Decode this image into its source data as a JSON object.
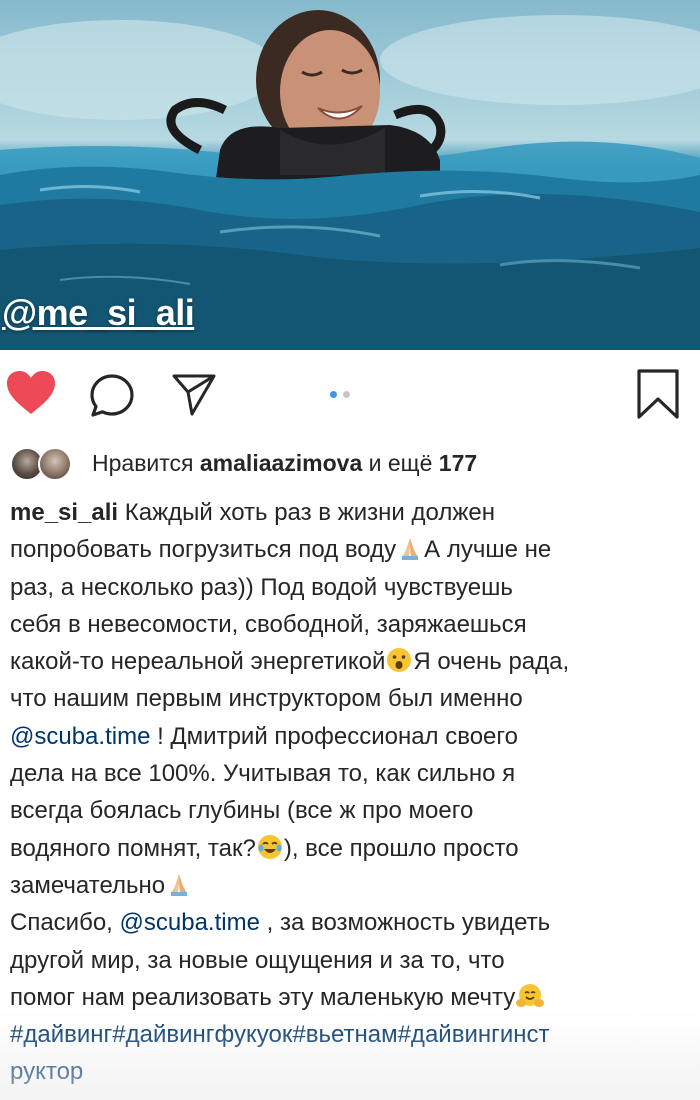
{
  "photo": {
    "overlay_mention": "@me_si_ali"
  },
  "actions": {
    "like_icon": "heart-filled-icon",
    "comment_icon": "comment-bubble-icon",
    "share_icon": "paper-plane-icon",
    "save_icon": "bookmark-icon",
    "like_color": "#ed4956",
    "carousel_active_color": "#3897f0",
    "carousel_pages": 2,
    "carousel_active_index": 1
  },
  "likes": {
    "prefix": "Нравится",
    "user": "amaliaazimova",
    "middle": "и ещё",
    "count": "177"
  },
  "caption": {
    "username": "me_si_ali",
    "l1": " Каждый хоть раз в жизни должен",
    "l2a": "попробовать погрузиться под воду",
    "l2b": "А лучше не",
    "l3": "раз, а несколько раз)) Под водой чувствуешь",
    "l4": "себя в невесомости, свободной, заряжаешься",
    "l5a": "какой-то нереальной энергетикой",
    "l5b": "Я очень рада,",
    "l6": "что нашим первым инструктором был именно",
    "l7_mention": "@scuba.time",
    "l7": " ! Дмитрий профессионал своего",
    "l8": "дела на все 100%. Учитывая то, как сильно я",
    "l9": "всегда боялась глубины (все ж про моего",
    "l10a": "водяного помнят, так?",
    "l10b": "), все прошло просто",
    "l11": "замечательно",
    "l12a": "Спасибо, ",
    "l12_mention": "@scuba.time",
    "l12b": " , за возможность увидеть",
    "l13": "другой мир, за новые ощущения и за то, что",
    "l14": "помог нам реализовать эту маленькую мечту",
    "l15_hashtags": "#дайвинг#дайвингфукуок#вьетнам#дайвингинст",
    "l16_hashtags": "руктор"
  },
  "emoji": {
    "praying_hands": "praying-hands-emoji",
    "surprised_face": "surprised-face-emoji",
    "tears_of_joy": "tears-of-joy-emoji",
    "hugging_face": "hugging-face-emoji"
  }
}
